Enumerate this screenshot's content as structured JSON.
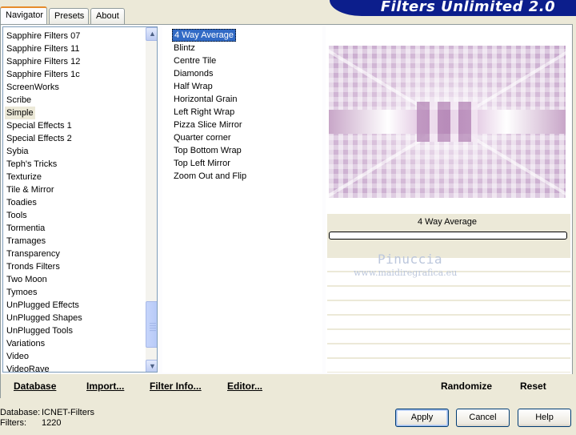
{
  "window": {
    "title": "Filters Unlimited 2.0"
  },
  "tabs": [
    {
      "label": "Navigator",
      "active": true
    },
    {
      "label": "Presets",
      "active": false
    },
    {
      "label": "About",
      "active": false
    }
  ],
  "categories": {
    "items": [
      "Sapphire Filters 07",
      "Sapphire Filters 11",
      "Sapphire Filters 12",
      "Sapphire Filters 1c",
      "ScreenWorks",
      "Scribe",
      "Simple",
      "Special Effects 1",
      "Special Effects 2",
      "Sybia",
      "Teph's Tricks",
      "Texturize",
      "Tile & Mirror",
      "Toadies",
      "Tools",
      "Tormentia",
      "Tramages",
      "Transparency",
      "Tronds Filters",
      "Two Moon",
      "Tymoes",
      "UnPlugged Effects",
      "UnPlugged Shapes",
      "UnPlugged Tools",
      "Variations",
      "Video",
      "VideoRave"
    ],
    "selected": "Simple"
  },
  "filters": {
    "items": [
      "4 Way Average",
      "Blintz",
      "Centre Tile",
      "Diamonds",
      "Half Wrap",
      "Horizontal Grain",
      "Left Right Wrap",
      "Pizza Slice Mirror",
      "Quarter corner",
      "Top Bottom Wrap",
      "Top Left Mirror",
      "Zoom Out and Flip"
    ],
    "selected": "4 Way Average"
  },
  "preview": {
    "filter_name": "4 Way Average"
  },
  "watermark": {
    "line1": "Pinuccia",
    "line2": "www.maidiregrafica.eu"
  },
  "buttons": {
    "database": "Database",
    "import": "Import...",
    "filter_info": "Filter Info...",
    "editor": "Editor...",
    "randomize": "Randomize",
    "reset": "Reset",
    "apply": "Apply",
    "cancel": "Cancel",
    "help": "Help"
  },
  "info": {
    "database_label": "Database:",
    "database_value": "ICNET-Filters",
    "filters_label": "Filters:",
    "filters_value": "1220"
  },
  "colors": {
    "title_banner": "#0c1e8c",
    "selection": "#316ac5",
    "face": "#ece9d8"
  }
}
